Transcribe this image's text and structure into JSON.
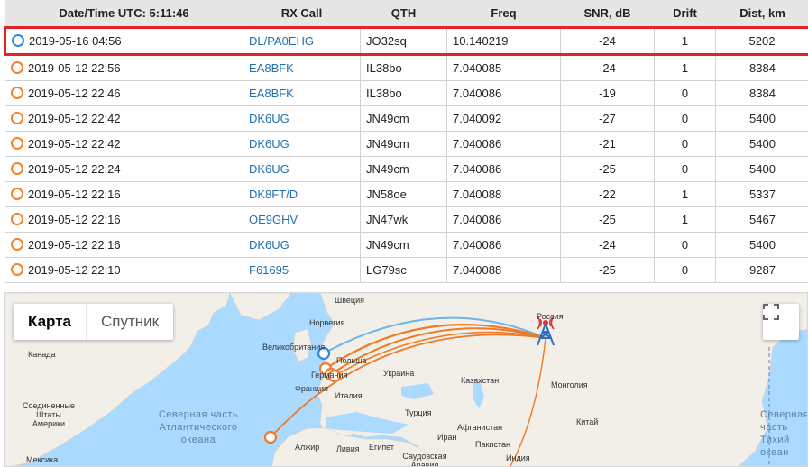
{
  "table": {
    "headers": {
      "datetime": "Date/Time UTC: 5:11:46",
      "rx_call": "RX Call",
      "qth": "QTH",
      "freq": "Freq",
      "snr": "SNR, dB",
      "drift": "Drift",
      "dist": "Dist, km"
    },
    "rows": [
      {
        "datetime": "2019-05-16 04:56",
        "rx_call": "DL/PA0EHG",
        "qth": "JO32sq",
        "freq": "10.140219",
        "snr": "-24",
        "drift": "1",
        "dist": "5202"
      },
      {
        "datetime": "2019-05-12 22:56",
        "rx_call": "EA8BFK",
        "qth": "IL38bo",
        "freq": "7.040085",
        "snr": "-24",
        "drift": "1",
        "dist": "8384"
      },
      {
        "datetime": "2019-05-12 22:46",
        "rx_call": "EA8BFK",
        "qth": "IL38bo",
        "freq": "7.040086",
        "snr": "-19",
        "drift": "0",
        "dist": "8384"
      },
      {
        "datetime": "2019-05-12 22:42",
        "rx_call": "DK6UG",
        "qth": "JN49cm",
        "freq": "7.040092",
        "snr": "-27",
        "drift": "0",
        "dist": "5400"
      },
      {
        "datetime": "2019-05-12 22:42",
        "rx_call": "DK6UG",
        "qth": "JN49cm",
        "freq": "7.040086",
        "snr": "-21",
        "drift": "0",
        "dist": "5400"
      },
      {
        "datetime": "2019-05-12 22:24",
        "rx_call": "DK6UG",
        "qth": "JN49cm",
        "freq": "7.040086",
        "snr": "-25",
        "drift": "0",
        "dist": "5400"
      },
      {
        "datetime": "2019-05-12 22:16",
        "rx_call": "DK8FT/D",
        "qth": "JN58oe",
        "freq": "7.040088",
        "snr": "-22",
        "drift": "1",
        "dist": "5337"
      },
      {
        "datetime": "2019-05-12 22:16",
        "rx_call": "OE9GHV",
        "qth": "JN47wk",
        "freq": "7.040086",
        "snr": "-25",
        "drift": "1",
        "dist": "5467"
      },
      {
        "datetime": "2019-05-12 22:16",
        "rx_call": "DK6UG",
        "qth": "JN49cm",
        "freq": "7.040086",
        "snr": "-24",
        "drift": "0",
        "dist": "5400"
      },
      {
        "datetime": "2019-05-12 22:10",
        "rx_call": "F61695",
        "qth": "LG79sc",
        "freq": "7.040088",
        "snr": "-25",
        "drift": "0",
        "dist": "9287"
      }
    ]
  },
  "map": {
    "type_map": "Карта",
    "type_satellite": "Спутник",
    "labels": {
      "sweden": "Швеция",
      "russia": "Россия",
      "norway": "Норвегия",
      "uk": "Великобритания",
      "poland": "Польша",
      "germany": "Германия",
      "ukraine": "Украина",
      "france": "Франция",
      "italy": "Италия",
      "kazakhstan": "Казахстан",
      "mongolia": "Монголия",
      "china": "Китай",
      "canada": "Канада",
      "usa": "Соединенные Штаты Америки",
      "mexico": "Мексика",
      "algeria": "Алжир",
      "libya": "Ливия",
      "egypt": "Египет",
      "saudi": "Саудовская Аравия",
      "turkey": "Турция",
      "iran": "Иран",
      "afghanistan": "Афганистан",
      "pakistan": "Пакистан",
      "india": "Индия"
    },
    "ocean_atlantic": "Северная часть Атлантического океана",
    "ocean_pacific": "Северная часть Тихий океан",
    "colors": {
      "arc_orange": "#f07a25",
      "arc_blue": "#6fb3e8",
      "tower": "#2a6fc9",
      "signal": "#e03030"
    }
  },
  "icons": {
    "status_marker": "circle-icon",
    "fullscreen": "fullscreen-icon",
    "tower": "radio-tower-icon"
  }
}
